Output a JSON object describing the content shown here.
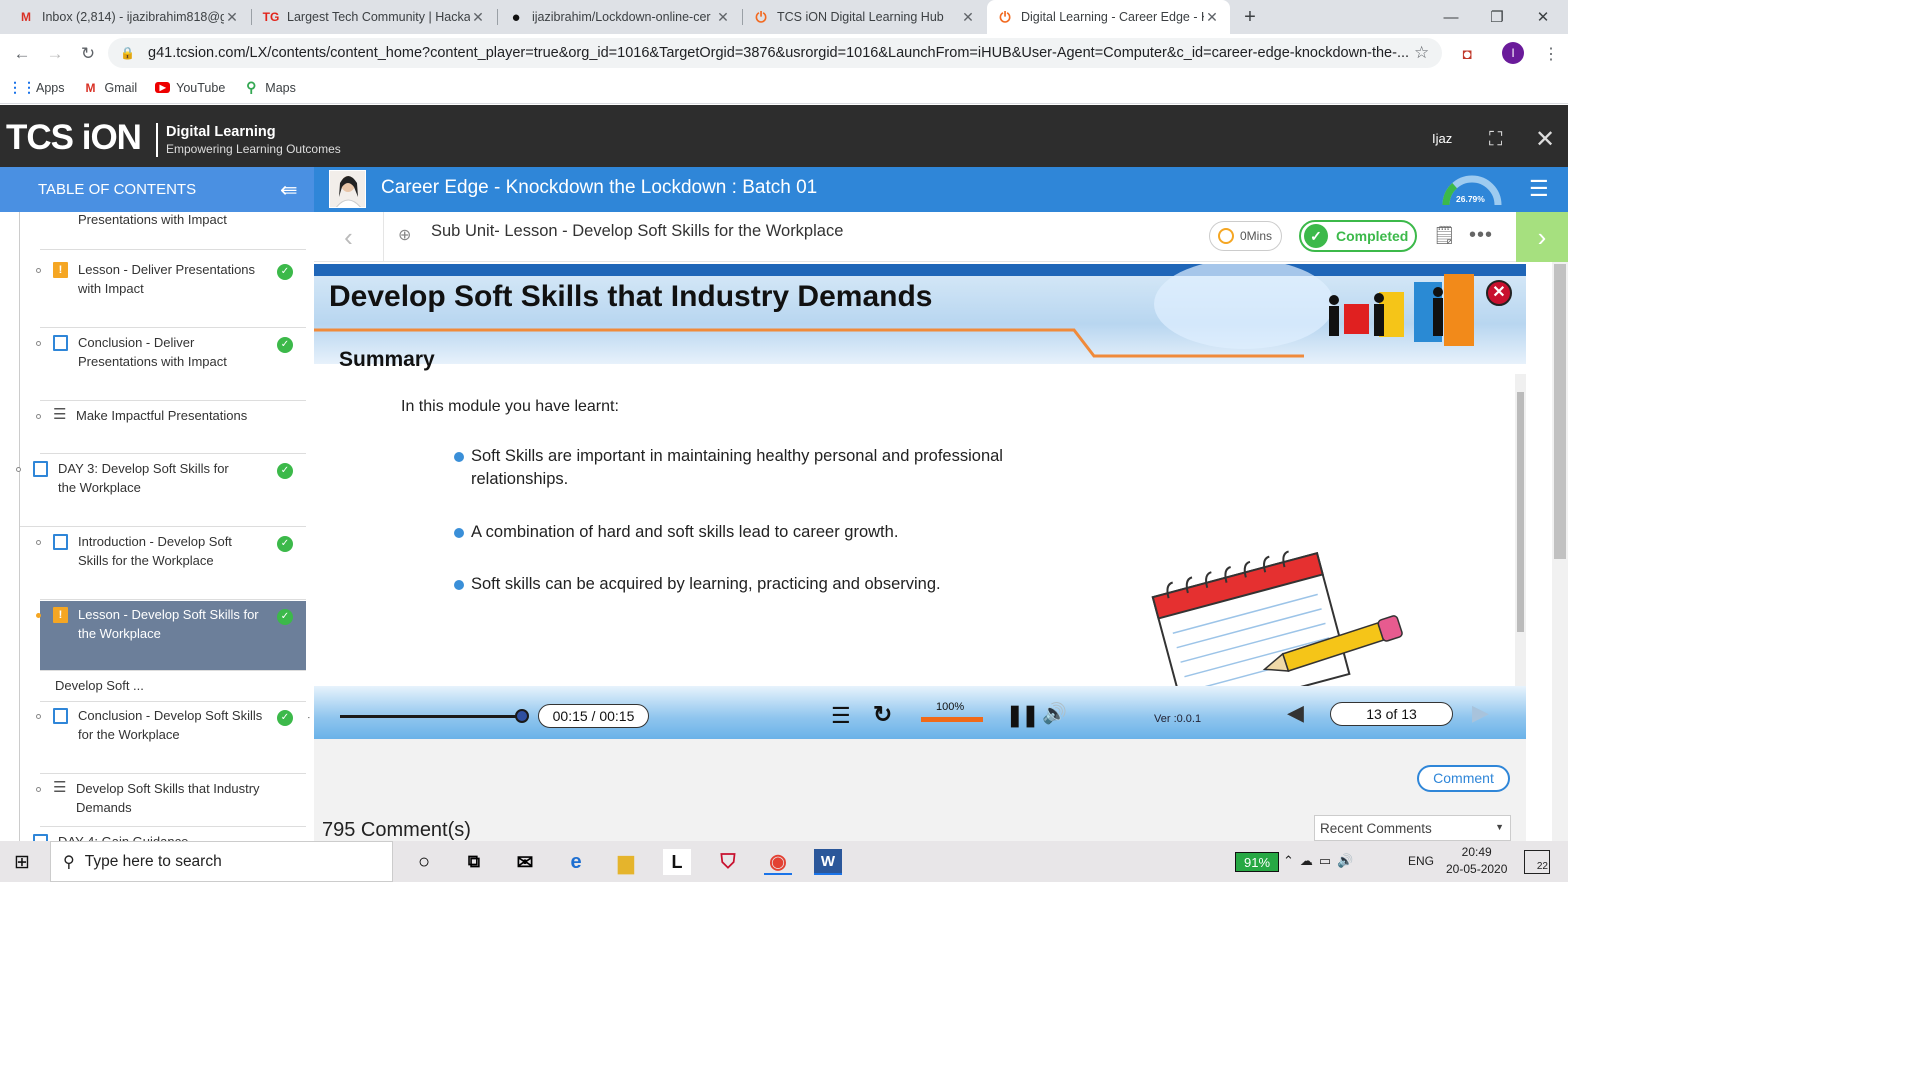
{
  "browser": {
    "tabs": [
      {
        "title": "Inbox (2,814) - ijazibrahim818@g",
        "favicon": "gmail-icon"
      },
      {
        "title": "Largest Tech Community | Hacka",
        "favicon": "techgig-icon"
      },
      {
        "title": "ijazibrahim/Lockdown-online-cer",
        "favicon": "github-icon"
      },
      {
        "title": "TCS iON Digital Learning Hub",
        "favicon": "tcs-icon"
      },
      {
        "title": "Digital Learning - Career Edge - K",
        "favicon": "tcs-icon"
      }
    ],
    "url": "g41.tcsion.com/LX/contents/content_home?content_player=true&org_id=1016&TargetOrgid=3876&usrorgid=1016&LaunchFrom=iHUB&User-Agent=Computer&c_id=career-edge-knockdown-the-...",
    "profile_initial": "I",
    "bookmarks": [
      "Apps",
      "Gmail",
      "YouTube",
      "Maps"
    ]
  },
  "app": {
    "logo": "TCS iON",
    "logo_title": "Digital Learning",
    "logo_subtitle": "Empowering Learning Outcomes",
    "user": "Ijaz"
  },
  "toc": {
    "header": "TABLE OF CONTENTS",
    "items": [
      {
        "title": "Presentations with Impact",
        "icon": "none",
        "check": false
      },
      {
        "title": "Lesson - Deliver Presentations with Impact",
        "icon": "warn",
        "check": true
      },
      {
        "title": "Conclusion - Deliver Presentations with Impact",
        "icon": "doc",
        "check": true
      },
      {
        "title": "Make Impactful Presentations",
        "icon": "list",
        "check": false
      },
      {
        "title": "DAY 3: Develop Soft Skills for the Workplace",
        "icon": "doc",
        "check": true
      },
      {
        "title": "Introduction - Develop Soft Skills for the Workplace",
        "icon": "doc",
        "check": true
      },
      {
        "title": "Lesson - Develop Soft Skills for the Workplace",
        "icon": "warn",
        "check": true
      },
      {
        "title": "Develop Soft ...",
        "icon": "none",
        "check": false
      },
      {
        "title": "Conclusion - Develop Soft Skills for the Workplace",
        "icon": "doc",
        "check": true
      },
      {
        "title": "Develop Soft Skills that Industry Demands",
        "icon": "list",
        "check": false
      },
      {
        "title": "DAY 4: Gain Guidance",
        "icon": "doc",
        "check": false
      }
    ]
  },
  "course": {
    "title": "Career Edge - Knockdown the Lockdown : Batch 01",
    "progress": "26.79%",
    "progress_value": 26.79
  },
  "lesson": {
    "subtitle": "Sub Unit- Lesson - Develop Soft Skills for the Workplace",
    "time": "0Mins",
    "status": "Completed"
  },
  "slide": {
    "banner_title": "Develop Soft Skills that Industry Demands",
    "heading": "Summary",
    "intro": "In this module you have learnt:",
    "points": [
      "Soft Skills are important in maintaining healthy personal and professional relationships.",
      "A combination of hard and soft skills lead to career growth.",
      "Soft skills can be acquired by learning, practicing and observing."
    ]
  },
  "player": {
    "time": "00:15 / 00:15",
    "volume": "100%",
    "version": "Ver :0.0.1",
    "slide_counter": "13 of 13",
    "seek_progress": 1.0
  },
  "comments": {
    "button": "Comment",
    "count": "795 Comment(s)",
    "sort": "Recent Comments"
  },
  "taskbar": {
    "search_placeholder": "Type here to search",
    "battery": "91%",
    "language": "ENG",
    "time": "20:49",
    "date": "20-05-2020",
    "notifications": "22"
  }
}
